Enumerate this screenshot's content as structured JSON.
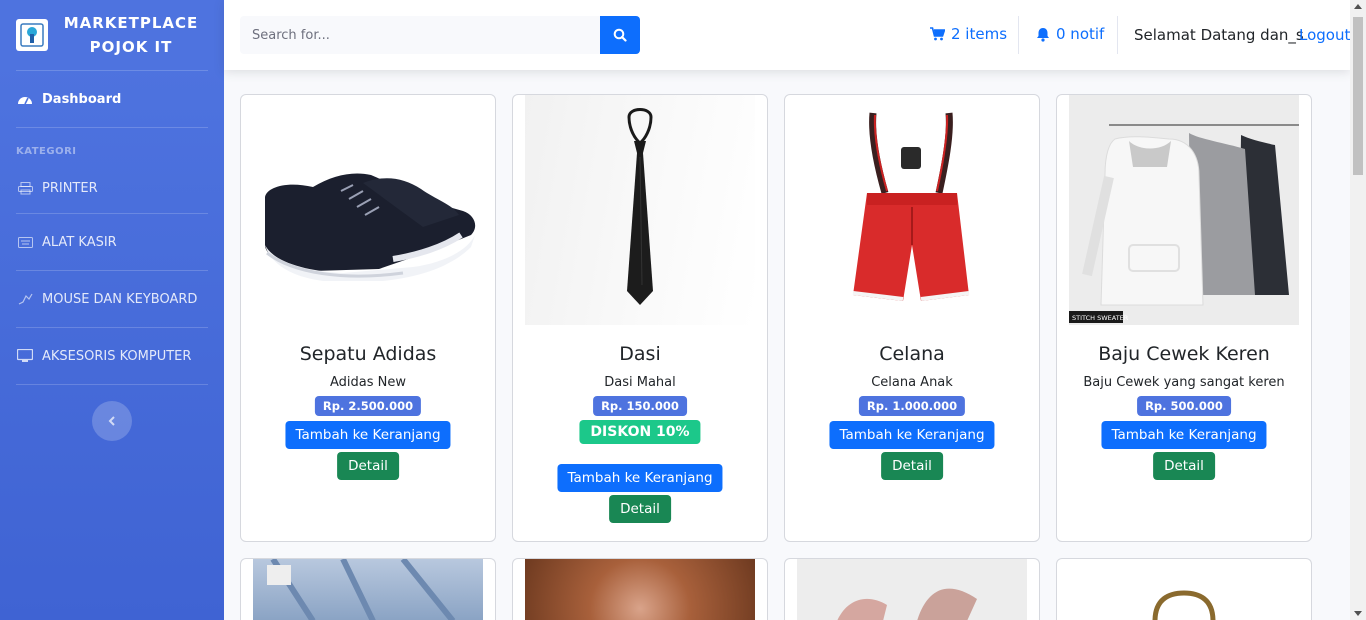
{
  "brand": {
    "line1": "MARKETPLACE",
    "line2": "POJOK IT"
  },
  "sidebar": {
    "dashboard": "Dashboard",
    "heading": "KATEGORI",
    "items": [
      "PRINTER",
      "ALAT KASIR",
      "MOUSE DAN KEYBOARD",
      "AKSESORIS KOMPUTER"
    ]
  },
  "topbar": {
    "search_placeholder": "Search for...",
    "cart": "2 items",
    "notif": "0 notif",
    "welcome": "Selamat Datang dan_s",
    "logout": "Logout"
  },
  "products": [
    {
      "title": "Sepatu Adidas",
      "desc": "Adidas New",
      "price": "Rp. 2.500.000",
      "cart": "Tambah ke Keranjang",
      "detail": "Detail"
    },
    {
      "title": "Dasi",
      "desc": "Dasi Mahal",
      "price": "Rp. 150.000",
      "discount": "DISKON 10%",
      "cart": "Tambah ke Keranjang",
      "detail": "Detail"
    },
    {
      "title": "Celana",
      "desc": "Celana Anak",
      "price": "Rp. 1.000.000",
      "cart": "Tambah ke Keranjang",
      "detail": "Detail"
    },
    {
      "title": "Baju Cewek Keren",
      "desc": "Baju Cewek yang sangat keren",
      "price": "Rp. 500.000",
      "cart": "Tambah ke Keranjang",
      "detail": "Detail",
      "img_caption": "STITCH SWEATER"
    }
  ],
  "colors": {
    "sidebar": "#4e73df",
    "primary": "#0d6efd",
    "success": "#198754",
    "discount": "#1cc88a"
  }
}
